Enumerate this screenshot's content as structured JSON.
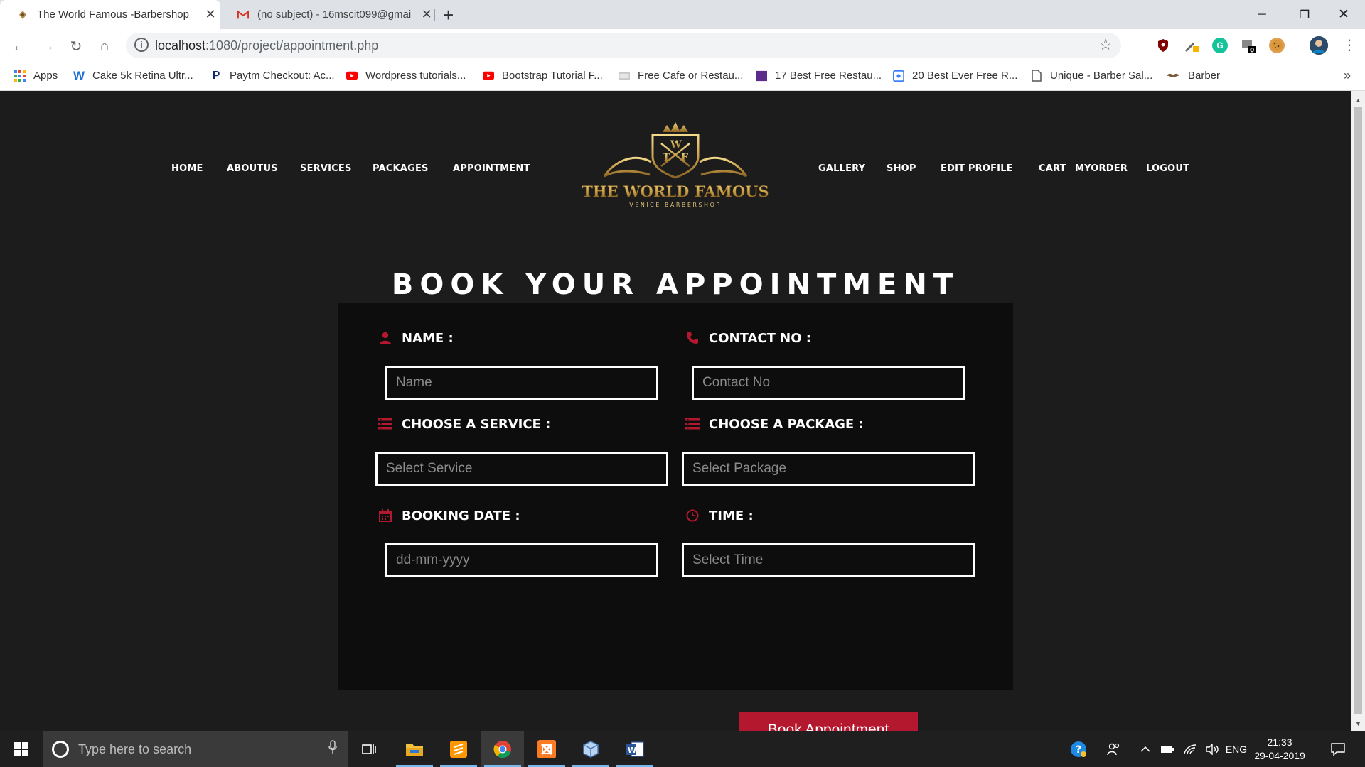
{
  "browser": {
    "tabs": [
      {
        "title": "The World Famous -Barbershop",
        "favicon": "barber-pole-icon",
        "active": true
      },
      {
        "title": "(no subject) - 16mscit099@gmail",
        "favicon": "gmail-icon",
        "active": false
      }
    ],
    "new_tab_symbol": "+",
    "url_host": "localhost",
    "url_path": ":1080/project/appointment.php",
    "bookmarks": [
      {
        "label": "Apps",
        "icon": "apps-grid-icon"
      },
      {
        "label": "Cake 5k Retina Ultr...",
        "icon": "w-logo-icon"
      },
      {
        "label": "Paytm Checkout: Ac...",
        "icon": "paytm-icon"
      },
      {
        "label": "Wordpress tutorials...",
        "icon": "youtube-icon"
      },
      {
        "label": "Bootstrap Tutorial F...",
        "icon": "youtube-icon"
      },
      {
        "label": "Free Cafe or Restau...",
        "icon": "css-icon"
      },
      {
        "label": "17 Best Free Restau...",
        "icon": "colorlib-icon"
      },
      {
        "label": "20 Best Ever Free R...",
        "icon": "dribbble-icon"
      },
      {
        "label": "Unique - Barber Sal...",
        "icon": "page-icon"
      },
      {
        "label": "Barber",
        "icon": "mustache-icon"
      }
    ]
  },
  "site": {
    "nav_left": [
      "HOME",
      "ABOUTUS",
      "SERVICES",
      "PACKAGES",
      "APPOINTMENT"
    ],
    "nav_right": [
      "GALLERY",
      "SHOP",
      "EDIT PROFILE",
      "CART",
      "MYORDER",
      "LOGOUT"
    ],
    "logo": {
      "monogram_left": "T",
      "monogram_top": "W",
      "monogram_right": "F",
      "title": "THE WORLD FAMOUS",
      "subtitle": "VENICE BARBERSHOP"
    },
    "heading": "BOOK YOUR APPOINTMENT",
    "form": {
      "name": {
        "label": "NAME :",
        "placeholder": "Name",
        "value": ""
      },
      "contact": {
        "label": "CONTACT NO :",
        "placeholder": "Contact No",
        "value": ""
      },
      "service": {
        "label": "CHOOSE A SERVICE :",
        "placeholder": "Select Service",
        "value": ""
      },
      "package": {
        "label": "CHOOSE A PACKAGE :",
        "placeholder": "Select Package",
        "value": ""
      },
      "date": {
        "label": "BOOKING DATE :",
        "placeholder": "dd-mm-yyyy",
        "value": ""
      },
      "time": {
        "label": "TIME :",
        "placeholder": "Select Time",
        "value": ""
      },
      "submit_label": "Book Appointment"
    },
    "colors": {
      "accent": "#b3182e",
      "background": "#1c1c1c",
      "panel": "#0d0d0d",
      "gold": "#c9a14a"
    }
  },
  "taskbar": {
    "search_placeholder": "Type here to search",
    "language": "ENG",
    "time": "21:33",
    "date": "29-04-2019"
  }
}
